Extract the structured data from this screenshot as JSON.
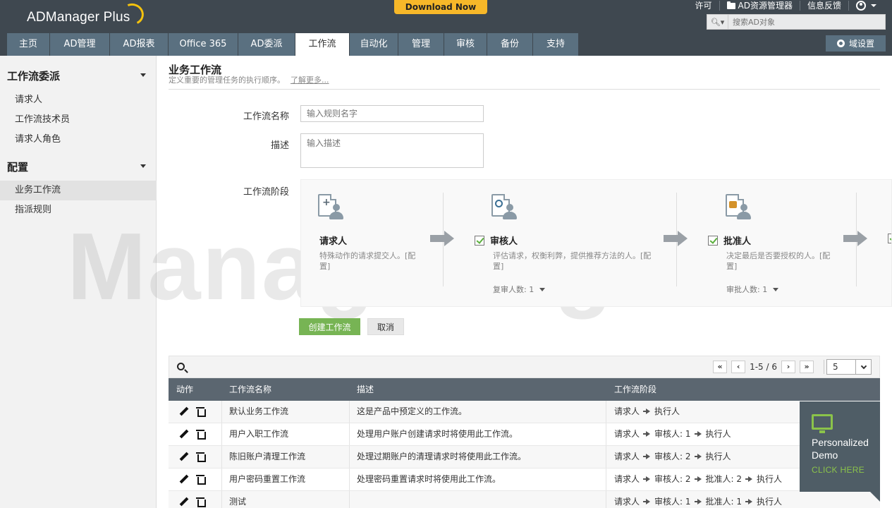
{
  "header": {
    "logo": "ADManager Plus",
    "download_label": "Download Now",
    "top_links": [
      "许可",
      "AD资源管理器",
      "信息反馈"
    ],
    "search_placeholder": "搜索AD对象",
    "domain_settings": "域设置"
  },
  "nav": {
    "tabs": [
      {
        "label": "主页",
        "w": 60
      },
      {
        "label": "AD管理",
        "w": 84
      },
      {
        "label": "AD报表",
        "w": 82
      },
      {
        "label": "Office 365",
        "w": 98
      },
      {
        "label": "AD委派",
        "w": 80
      },
      {
        "label": "工作流",
        "w": 76
      },
      {
        "label": "自动化",
        "w": 68
      },
      {
        "label": "管理",
        "w": 64
      },
      {
        "label": "审核",
        "w": 60
      },
      {
        "label": "备份",
        "w": 64
      },
      {
        "label": "支持",
        "w": 64
      }
    ],
    "active": "工作流"
  },
  "sidebar": {
    "section1": "工作流委派",
    "items1": [
      "请求人",
      "工作流技术员",
      "请求人角色"
    ],
    "section2": "配置",
    "items2": [
      "业务工作流",
      "指派规则"
    ]
  },
  "page": {
    "title": "业务工作流",
    "subtitle": "定义重要的管理任务的执行顺序。",
    "learn_more": "了解更多..."
  },
  "form": {
    "name_label": "工作流名称",
    "name_placeholder": "输入规则名字",
    "desc_label": "描述",
    "desc_placeholder": "输入描述",
    "stages_label": "工作流阶段"
  },
  "stages": [
    {
      "title": "请求人",
      "desc": "特殊动作的请求提交人。[配置]",
      "count": ""
    },
    {
      "title": "审核人",
      "desc": "评估请求，权衡利弊，提供推荐方法的人。[配置]",
      "count": "复审人数: 1"
    },
    {
      "title": "批准人",
      "desc": "决定最后是否要授权的人。[配置]",
      "count": "审批人数: 1"
    }
  ],
  "buttons": {
    "create": "创建工作流",
    "cancel": "取消"
  },
  "pager": {
    "range": "1-5 / 6",
    "per_page": "5"
  },
  "table": {
    "headers": [
      "动作",
      "工作流名称",
      "描述",
      "工作流阶段"
    ],
    "rows": [
      {
        "name": "默认业务工作流",
        "desc": "这是产品中预定义的工作流。",
        "stages": [
          "请求人",
          "执行人"
        ]
      },
      {
        "name": "用户入职工作流",
        "desc": "处理用户账户创建请求时将使用此工作流。",
        "stages": [
          "请求人",
          "审核人: 1",
          "执行人"
        ]
      },
      {
        "name": "陈旧账户清理工作流",
        "desc": "处理过期账户的清理请求时将使用此工作流。",
        "stages": [
          "请求人",
          "审核人: 2",
          "执行人"
        ]
      },
      {
        "name": "用户密码重置工作流",
        "desc": "处理密码重置请求时将使用此工作流。",
        "stages": [
          "请求人",
          "审核人: 2",
          "批准人: 2",
          "执行人"
        ]
      },
      {
        "name": "测试",
        "desc": "",
        "stages": [
          "请求人",
          "审核人: 1",
          "批准人: 1",
          "执行人"
        ]
      }
    ]
  },
  "demo": {
    "line1": "Personalized",
    "line2": "Demo",
    "cta": "CLICK HERE"
  },
  "watermark": "ManageEngine"
}
